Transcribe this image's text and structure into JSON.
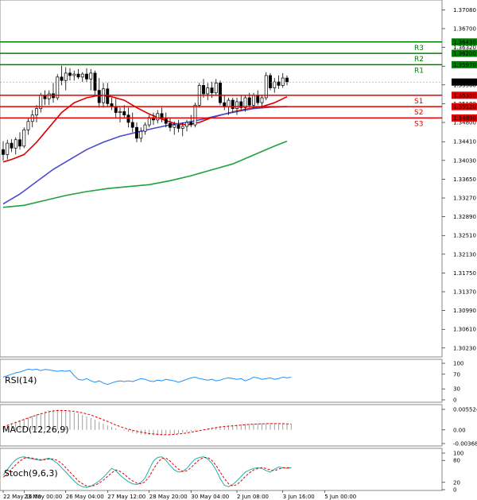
{
  "chart_data": {
    "type": "candlestick",
    "price_axis": {
      "ylim": [
        1.3005,
        1.3728
      ],
      "ticks": [
        "1.37080",
        "1.36700",
        "1.36320",
        "1.35940",
        "1.35560",
        "1.35180",
        "1.34800",
        "1.34410",
        "1.34030",
        "1.33650",
        "1.33270",
        "1.32890",
        "1.32510",
        "1.32130",
        "1.31750",
        "1.31370",
        "1.30990",
        "1.30610",
        "1.30230"
      ],
      "tick_values": [
        1.3708,
        1.367,
        1.3632,
        1.3594,
        1.3556,
        1.3518,
        1.348,
        1.3441,
        1.3403,
        1.3365,
        1.3327,
        1.3289,
        1.3251,
        1.3213,
        1.3175,
        1.3137,
        1.3099,
        1.3061,
        1.3023
      ],
      "current_price": "1.35618",
      "current_value": 1.35618
    },
    "levels": [
      {
        "name": "R3",
        "price": "1.36430",
        "value": 1.3643,
        "color": "#008000"
      },
      {
        "name": "R2",
        "price": "1.36200",
        "value": 1.362,
        "color": "#008000"
      },
      {
        "name": "R1",
        "price": "1.35970",
        "value": 1.3597,
        "color": "#008000"
      },
      {
        "name": "S1",
        "price": "1.35350",
        "value": 1.3535,
        "color": "#e00000"
      },
      {
        "name": "S2",
        "price": "1.35120",
        "value": 1.3512,
        "color": "#e00000"
      },
      {
        "name": "S3",
        "price": "1.34890",
        "value": 1.3489,
        "color": "#e00000"
      }
    ],
    "x_labels": [
      "22 May 16:00",
      "23 May 00:00",
      "26 May 04:00",
      "27 May 12:00",
      "28 May 20:00",
      "30 May 04:00",
      "2 Jun 08:00",
      "3 Jun 16:00",
      "5 Jun 00:00"
    ],
    "x_label_bar_index": [
      0,
      5,
      15,
      25,
      35,
      45,
      56,
      67,
      77
    ],
    "candles": [
      [
        1.3425,
        1.3442,
        1.3403,
        1.3415
      ],
      [
        1.3415,
        1.3445,
        1.3405,
        1.3438
      ],
      [
        1.3438,
        1.3446,
        1.342,
        1.3428
      ],
      [
        1.3428,
        1.345,
        1.3415,
        1.3445
      ],
      [
        1.3445,
        1.346,
        1.3425,
        1.3432
      ],
      [
        1.3432,
        1.347,
        1.3428,
        1.3465
      ],
      [
        1.3465,
        1.349,
        1.3455,
        1.3482
      ],
      [
        1.3482,
        1.3505,
        1.347,
        1.3495
      ],
      [
        1.3495,
        1.3515,
        1.348,
        1.3508
      ],
      [
        1.3508,
        1.354,
        1.35,
        1.3535
      ],
      [
        1.3535,
        1.3545,
        1.3515,
        1.3528
      ],
      [
        1.3528,
        1.3545,
        1.3515,
        1.3538
      ],
      [
        1.3538,
        1.356,
        1.352,
        1.353
      ],
      [
        1.353,
        1.3578,
        1.3525,
        1.3572
      ],
      [
        1.3572,
        1.3595,
        1.3555,
        1.3565
      ],
      [
        1.3565,
        1.3592,
        1.3545,
        1.358
      ],
      [
        1.358,
        1.359,
        1.3565,
        1.3575
      ],
      [
        1.3575,
        1.3585,
        1.3565,
        1.3578
      ],
      [
        1.3578,
        1.3588,
        1.3568,
        1.3572
      ],
      [
        1.3572,
        1.3582,
        1.3562,
        1.3578
      ],
      [
        1.3578,
        1.359,
        1.3562,
        1.3568
      ],
      [
        1.3568,
        1.3588,
        1.3545,
        1.358
      ],
      [
        1.358,
        1.3585,
        1.3535,
        1.3545
      ],
      [
        1.3545,
        1.357,
        1.351,
        1.352
      ],
      [
        1.352,
        1.356,
        1.351,
        1.3548
      ],
      [
        1.3548,
        1.356,
        1.3512,
        1.3518
      ],
      [
        1.3518,
        1.353,
        1.3505,
        1.3512
      ],
      [
        1.3512,
        1.3528,
        1.349,
        1.35
      ],
      [
        1.35,
        1.351,
        1.348,
        1.3502
      ],
      [
        1.3502,
        1.3515,
        1.349,
        1.3495
      ],
      [
        1.3495,
        1.351,
        1.347,
        1.348
      ],
      [
        1.348,
        1.35,
        1.346,
        1.347
      ],
      [
        1.347,
        1.348,
        1.344,
        1.3448
      ],
      [
        1.3448,
        1.347,
        1.344,
        1.3462
      ],
      [
        1.3462,
        1.348,
        1.3455,
        1.3475
      ],
      [
        1.3475,
        1.3495,
        1.347,
        1.349
      ],
      [
        1.349,
        1.35,
        1.3475,
        1.3485
      ],
      [
        1.3485,
        1.3505,
        1.3478,
        1.3498
      ],
      [
        1.3498,
        1.351,
        1.348,
        1.3488
      ],
      [
        1.3488,
        1.35,
        1.347,
        1.3478
      ],
      [
        1.3478,
        1.349,
        1.3462,
        1.347
      ],
      [
        1.347,
        1.3482,
        1.3455,
        1.3475
      ],
      [
        1.3475,
        1.3485,
        1.346,
        1.3468
      ],
      [
        1.3468,
        1.348,
        1.3452,
        1.3472
      ],
      [
        1.3472,
        1.3485,
        1.3462,
        1.348
      ],
      [
        1.348,
        1.3495,
        1.347,
        1.3475
      ],
      [
        1.3475,
        1.352,
        1.347,
        1.3515
      ],
      [
        1.3515,
        1.356,
        1.351,
        1.3555
      ],
      [
        1.3555,
        1.3568,
        1.353,
        1.3538
      ],
      [
        1.3538,
        1.356,
        1.3525,
        1.355
      ],
      [
        1.355,
        1.3562,
        1.353,
        1.354
      ],
      [
        1.354,
        1.3568,
        1.3535,
        1.356
      ],
      [
        1.356,
        1.3565,
        1.3515,
        1.352
      ],
      [
        1.352,
        1.3535,
        1.3505,
        1.3512
      ],
      [
        1.3512,
        1.353,
        1.3495,
        1.3525
      ],
      [
        1.3525,
        1.353,
        1.35,
        1.3508
      ],
      [
        1.3508,
        1.353,
        1.3495,
        1.3522
      ],
      [
        1.3522,
        1.3535,
        1.3505,
        1.351
      ],
      [
        1.351,
        1.3535,
        1.3502,
        1.353
      ],
      [
        1.353,
        1.354,
        1.351,
        1.3515
      ],
      [
        1.3515,
        1.354,
        1.3508,
        1.3535
      ],
      [
        1.3535,
        1.3545,
        1.3515,
        1.352
      ],
      [
        1.352,
        1.3535,
        1.351,
        1.353
      ],
      [
        1.353,
        1.3582,
        1.3525,
        1.3575
      ],
      [
        1.3575,
        1.358,
        1.3545,
        1.355
      ],
      [
        1.355,
        1.357,
        1.354,
        1.3562
      ],
      [
        1.3562,
        1.3575,
        1.3548,
        1.3555
      ],
      [
        1.3555,
        1.358,
        1.355,
        1.357
      ],
      [
        1.357,
        1.3575,
        1.3555,
        1.3562
      ]
    ],
    "ma_lines": [
      {
        "color": "#e00000",
        "points": [
          [
            0,
            1.34
          ],
          [
            2,
            1.3405
          ],
          [
            5,
            1.3415
          ],
          [
            8,
            1.344
          ],
          [
            11,
            1.347
          ],
          [
            14,
            1.35
          ],
          [
            17,
            1.352
          ],
          [
            20,
            1.353
          ],
          [
            23,
            1.3535
          ],
          [
            26,
            1.3532
          ],
          [
            29,
            1.3525
          ],
          [
            32,
            1.351
          ],
          [
            35,
            1.3497
          ],
          [
            38,
            1.3487
          ],
          [
            41,
            1.3478
          ],
          [
            44,
            1.3475
          ],
          [
            47,
            1.348
          ],
          [
            50,
            1.349
          ],
          [
            53,
            1.3497
          ],
          [
            56,
            1.3503
          ],
          [
            59,
            1.3508
          ],
          [
            62,
            1.3512
          ],
          [
            65,
            1.352
          ],
          [
            68,
            1.3532
          ]
        ]
      },
      {
        "color": "#4a4ad0",
        "points": [
          [
            0,
            1.3315
          ],
          [
            4,
            1.3335
          ],
          [
            8,
            1.336
          ],
          [
            12,
            1.3385
          ],
          [
            16,
            1.3405
          ],
          [
            20,
            1.3425
          ],
          [
            24,
            1.344
          ],
          [
            28,
            1.3452
          ],
          [
            32,
            1.346
          ],
          [
            36,
            1.3468
          ],
          [
            40,
            1.3475
          ],
          [
            44,
            1.348
          ],
          [
            48,
            1.3487
          ],
          [
            52,
            1.3495
          ],
          [
            56,
            1.3502
          ],
          [
            60,
            1.3508
          ],
          [
            64,
            1.3511
          ],
          [
            68,
            1.3512
          ]
        ]
      },
      {
        "color": "#20a040",
        "points": [
          [
            0,
            1.3308
          ],
          [
            5,
            1.3312
          ],
          [
            10,
            1.3322
          ],
          [
            15,
            1.3332
          ],
          [
            20,
            1.334
          ],
          [
            25,
            1.3346
          ],
          [
            30,
            1.335
          ],
          [
            35,
            1.3354
          ],
          [
            40,
            1.3362
          ],
          [
            45,
            1.3372
          ],
          [
            50,
            1.3384
          ],
          [
            55,
            1.3396
          ],
          [
            60,
            1.3414
          ],
          [
            65,
            1.3432
          ],
          [
            68,
            1.3442
          ]
        ]
      }
    ],
    "rsi": {
      "title": "RSI(14)",
      "ticks": [
        "100",
        "70",
        "30",
        "0"
      ],
      "tick_values": [
        100,
        70,
        30,
        0
      ],
      "values": [
        62,
        66,
        70,
        74,
        76,
        80,
        84,
        82,
        84,
        80,
        83,
        82,
        80,
        78,
        80,
        78,
        80,
        66,
        56,
        54,
        58,
        52,
        48,
        52,
        46,
        42,
        46,
        50,
        52,
        50,
        52,
        50,
        54,
        58,
        56,
        52,
        50,
        54,
        52,
        56,
        54,
        52,
        48,
        52,
        56,
        60,
        62,
        58,
        56,
        54,
        56,
        52,
        54,
        58,
        60,
        58,
        56,
        58,
        52,
        56,
        62,
        60,
        56,
        58,
        60,
        56,
        58,
        62,
        60,
        62
      ]
    },
    "macd": {
      "title": "MACD(12,26,9)",
      "ticks": [
        "0.005524",
        "0.00",
        "-0.003685"
      ],
      "tick_values": [
        0.005524,
        0,
        -0.003685
      ],
      "histogram": [
        0.001,
        0.0014,
        0.0018,
        0.0022,
        0.0026,
        0.003,
        0.0034,
        0.0038,
        0.0042,
        0.0046,
        0.005,
        0.0052,
        0.0054,
        0.0055,
        0.0054,
        0.0052,
        0.005,
        0.0047,
        0.0044,
        0.004,
        0.0036,
        0.0032,
        0.0027,
        0.0022,
        0.0017,
        0.0012,
        0.0008,
        0.0004,
        0.0001,
        -0.0002,
        -0.0005,
        -0.0008,
        -0.001,
        -0.0012,
        -0.0013,
        -0.0014,
        -0.0015,
        -0.0015,
        -0.0015,
        -0.0014,
        -0.0013,
        -0.0012,
        -0.001,
        -0.0008,
        -0.0006,
        -0.0004,
        -0.0002,
        0.0,
        0.0002,
        0.0004,
        0.0006,
        0.0008,
        0.001,
        0.0011,
        0.0012,
        0.0013,
        0.0014,
        0.0015,
        0.0016,
        0.0016,
        0.0017,
        0.0017,
        0.0018,
        0.0018,
        0.0018,
        0.0018,
        0.0017,
        0.0017,
        0.0016,
        0.0016
      ],
      "signal": [
        0.0008,
        0.0012,
        0.0016,
        0.002,
        0.0024,
        0.0028,
        0.0032,
        0.0036,
        0.004,
        0.0043,
        0.0046,
        0.0049,
        0.0051,
        0.0052,
        0.0052,
        0.0052,
        0.0051,
        0.005,
        0.0048,
        0.0046,
        0.0043,
        0.004,
        0.0036,
        0.0032,
        0.0027,
        0.0023,
        0.0018,
        0.0013,
        0.0009,
        0.0005,
        0.0002,
        -0.0001,
        -0.0004,
        -0.0006,
        -0.0008,
        -0.001,
        -0.0011,
        -0.0012,
        -0.0013,
        -0.0013,
        -0.0013,
        -0.0012,
        -0.0011,
        -0.001,
        -0.0008,
        -0.0006,
        -0.0004,
        -0.0002,
        0.0,
        0.0002,
        0.0004,
        0.0006,
        0.0008,
        0.0009,
        0.001,
        0.0011,
        0.0012,
        0.0013,
        0.0014,
        0.0015,
        0.0015,
        0.0016,
        0.0016,
        0.0017,
        0.0017,
        0.0017,
        0.0017,
        0.0017,
        0.0016,
        0.0016
      ]
    },
    "stoch": {
      "title": "Stoch(9,6,3)",
      "ticks": [
        "100",
        "80",
        "20",
        "0"
      ],
      "tick_values": [
        100,
        80,
        20,
        0
      ],
      "k": [
        40,
        55,
        70,
        82,
        88,
        90,
        86,
        84,
        82,
        80,
        84,
        86,
        80,
        72,
        60,
        48,
        36,
        24,
        14,
        8,
        6,
        10,
        16,
        24,
        34,
        46,
        58,
        52,
        40,
        30,
        22,
        16,
        14,
        20,
        32,
        56,
        78,
        88,
        90,
        80,
        66,
        54,
        48,
        50,
        58,
        72,
        84,
        88,
        90,
        84,
        72,
        54,
        30,
        12,
        8,
        14,
        24,
        36,
        48,
        54,
        58,
        60,
        58,
        52,
        48,
        56,
        62,
        60,
        58,
        60
      ],
      "d": [
        34,
        44,
        56,
        68,
        78,
        86,
        88,
        86,
        84,
        82,
        82,
        84,
        84,
        80,
        72,
        60,
        48,
        36,
        24,
        16,
        10,
        9,
        12,
        18,
        26,
        36,
        46,
        54,
        50,
        42,
        32,
        24,
        18,
        16,
        22,
        36,
        56,
        74,
        86,
        86,
        78,
        66,
        56,
        50,
        52,
        60,
        72,
        82,
        88,
        88,
        80,
        66,
        48,
        30,
        16,
        10,
        14,
        24,
        36,
        46,
        54,
        58,
        60,
        58,
        54,
        52,
        56,
        60,
        60,
        60
      ]
    }
  }
}
